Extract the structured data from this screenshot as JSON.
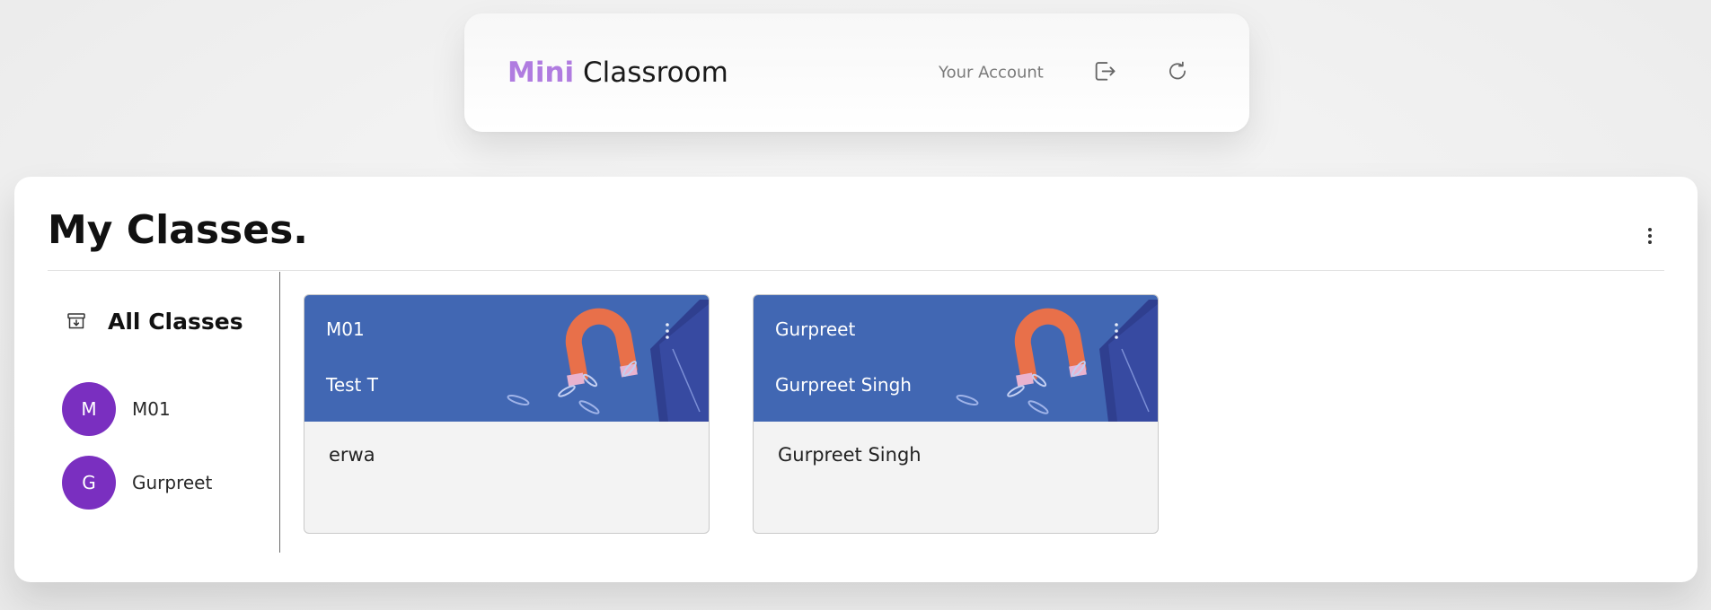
{
  "header": {
    "brand_accent": "Mini",
    "brand_rest": "Classroom",
    "account_link": "Your Account",
    "logout_icon": "logout-icon",
    "refresh_icon": "refresh-icon"
  },
  "main": {
    "title": "My Classes.",
    "menu_icon": "more-vertical-icon"
  },
  "sidebar": {
    "all_classes": {
      "icon": "archive-icon",
      "label": "All Classes"
    },
    "items": [
      {
        "avatar": "M",
        "label": "M01"
      },
      {
        "avatar": "G",
        "label": "Gurpreet"
      }
    ]
  },
  "cards": [
    {
      "title": "M01",
      "subtitle": "Test T",
      "description": "erwa"
    },
    {
      "title": "Gurpreet",
      "subtitle": "Gurpreet Singh",
      "description": "Gurpreet Singh"
    }
  ],
  "colors": {
    "brand_accent": "#b07ce0",
    "avatar": "#7a2fc0",
    "card_banner": "#4167b3",
    "card_body": "#f3f3f3"
  }
}
